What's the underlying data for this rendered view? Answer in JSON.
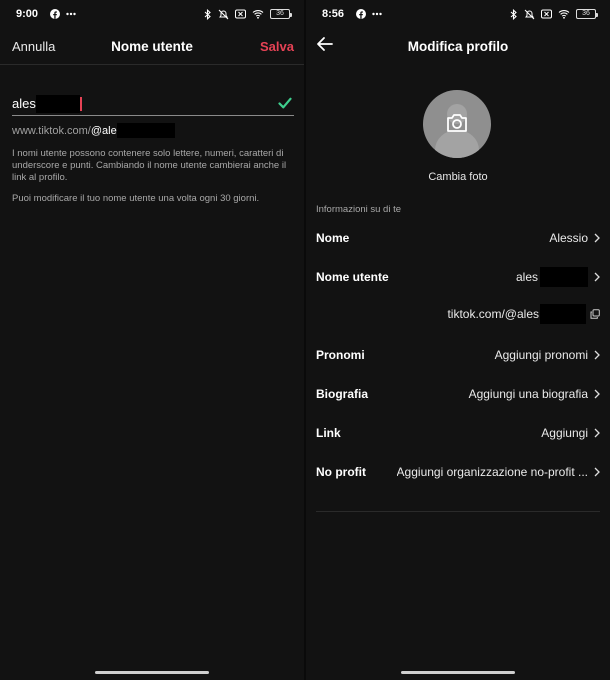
{
  "left_screen": {
    "status_bar": {
      "time": "9:00",
      "battery": "36"
    },
    "header": {
      "cancel_label": "Annulla",
      "title": "Nome utente",
      "save_label": "Salva"
    },
    "username_input": {
      "value": "ales"
    },
    "profile_url": {
      "prefix": "www.tiktok.com/",
      "handle": "@ale"
    },
    "hint_rules": "I nomi utente possono contenere solo lettere, numeri, caratteri di underscore e punti. Cambiando il nome utente cambierai anche il link al profilo.",
    "hint_frequency": "Puoi modificare il tuo nome utente una volta ogni 30 giorni."
  },
  "right_screen": {
    "status_bar": {
      "time": "8:56",
      "battery": "36"
    },
    "header": {
      "title": "Modifica profilo"
    },
    "avatar": {
      "change_label": "Cambia foto"
    },
    "section_title": "Informazioni su di te",
    "rows": [
      {
        "label": "Nome",
        "value": "Alessio"
      },
      {
        "label": "Nome utente",
        "value": "ales"
      },
      {
        "label": "Pronomi",
        "value": "Aggiungi pronomi"
      },
      {
        "label": "Biografia",
        "value": "Aggiungi una biografia"
      },
      {
        "label": "Link",
        "value": "Aggiungi"
      },
      {
        "label": "No profit",
        "value": "Aggiungi organizzazione no-profit ..."
      }
    ],
    "profile_link": "tiktok.com/@ales"
  },
  "colors": {
    "background": "#121212",
    "accent": "#e64255",
    "success": "#3ecf8e",
    "text_muted": "#a8a8a8"
  },
  "icons": [
    "facebook-icon",
    "bluetooth-icon",
    "mute-icon",
    "close-box-icon",
    "wifi-icon",
    "battery-icon",
    "check-icon",
    "back-arrow-icon",
    "camera-icon",
    "chevron-right-icon",
    "copy-icon"
  ]
}
